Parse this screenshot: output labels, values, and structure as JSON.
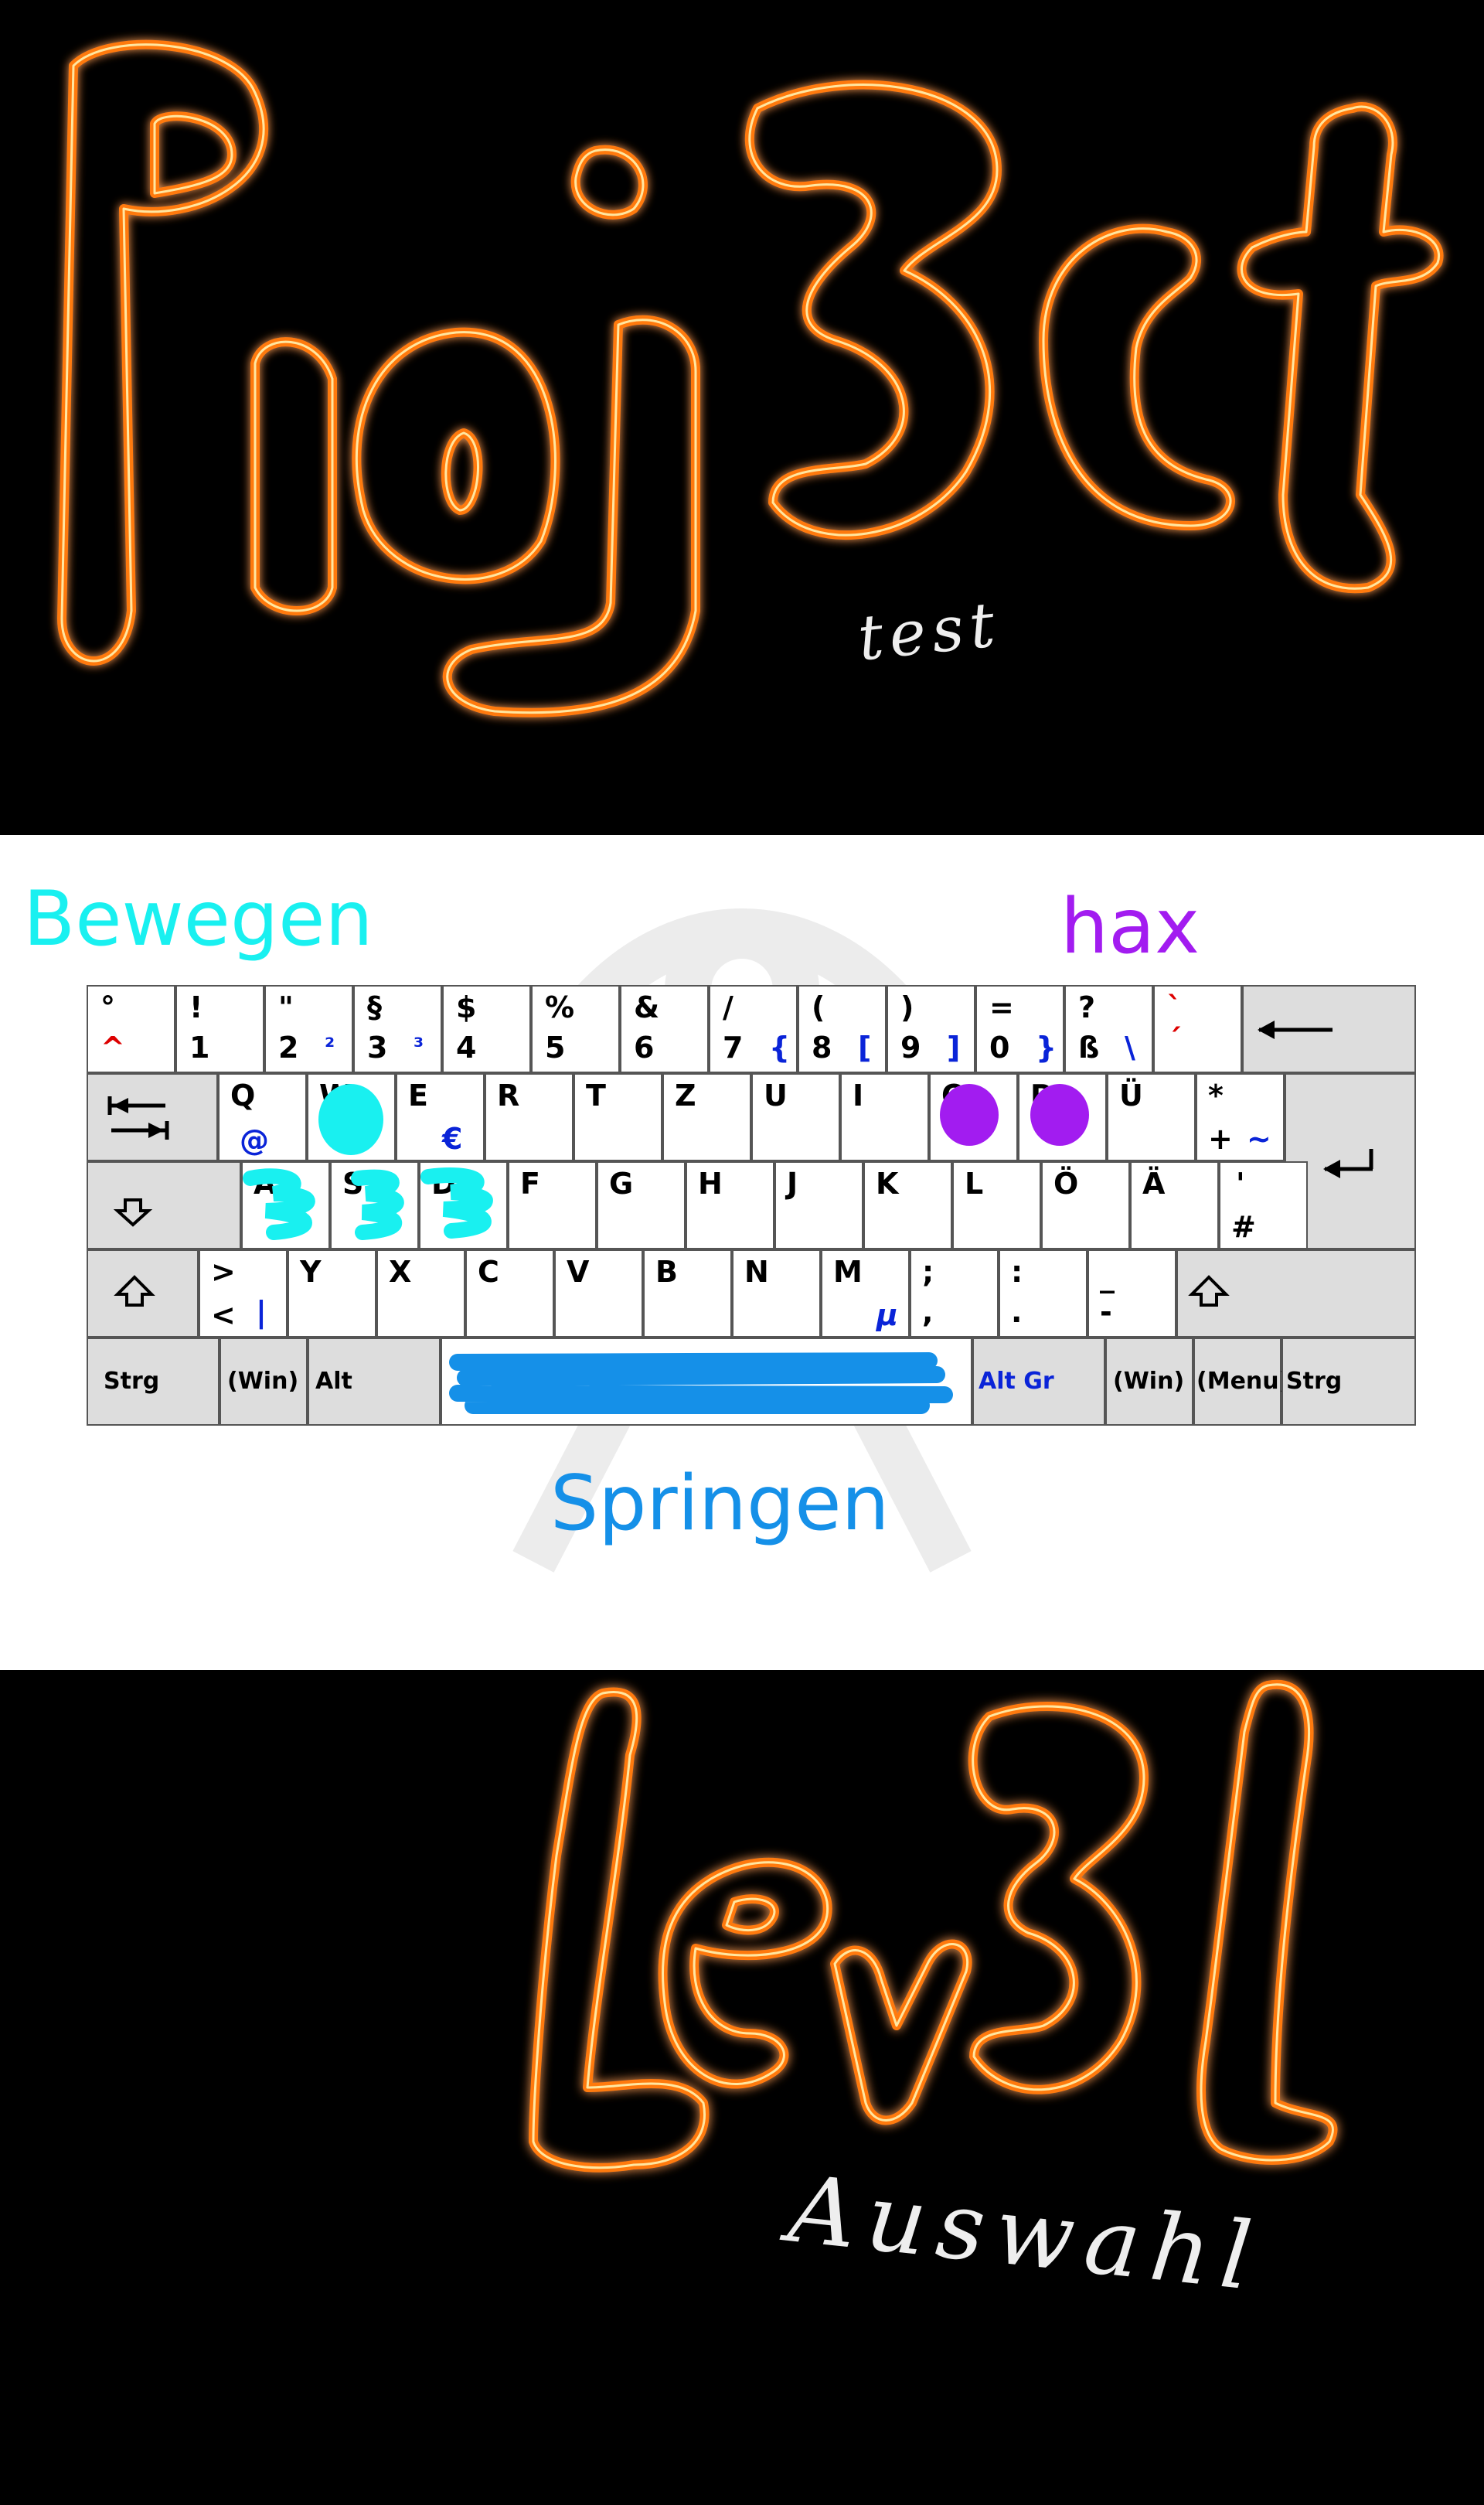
{
  "colors": {
    "fire": "#ff7a10",
    "fire_core": "#fff2b0",
    "bewegen": "#19f0f0",
    "hax": "#a21cf0",
    "springen": "#1590e8",
    "altgr": "#0a24d8"
  },
  "top": {
    "title_word": "Proj3ct",
    "subtitle": "test"
  },
  "middle": {
    "bewegen_label": "Bewegen",
    "hax_label": "hax",
    "springen_label": "Springen",
    "keyboard": {
      "row1": [
        {
          "top": "°",
          "bot": "^"
        },
        {
          "top": "!",
          "bot": "1"
        },
        {
          "top": "\"",
          "bot": "2",
          "alt": "²"
        },
        {
          "top": "§",
          "bot": "3",
          "alt": "³"
        },
        {
          "top": "$",
          "bot": "4"
        },
        {
          "top": "%",
          "bot": "5"
        },
        {
          "top": "&",
          "bot": "6"
        },
        {
          "top": "/",
          "bot": "7",
          "alt": "{"
        },
        {
          "top": "(",
          "bot": "8",
          "alt": "["
        },
        {
          "top": ")",
          "bot": "9",
          "alt": "]"
        },
        {
          "top": "=",
          "bot": "0",
          "alt": "}"
        },
        {
          "top": "?",
          "bot": "ß",
          "alt": "\\"
        },
        {
          "top": "`",
          "bot": "´"
        }
      ],
      "row2": [
        {
          "top": "Q",
          "alt": "@"
        },
        {
          "top": "W"
        },
        {
          "top": "E",
          "alt": "€"
        },
        {
          "top": "R"
        },
        {
          "top": "T"
        },
        {
          "top": "Z"
        },
        {
          "top": "U"
        },
        {
          "top": "I"
        },
        {
          "top": "O"
        },
        {
          "top": "P"
        },
        {
          "top": "Ü"
        },
        {
          "top": "*",
          "bot": "+",
          "alt": "~"
        }
      ],
      "row3": [
        {
          "top": "A"
        },
        {
          "top": "S"
        },
        {
          "top": "D"
        },
        {
          "top": "F"
        },
        {
          "top": "G"
        },
        {
          "top": "H"
        },
        {
          "top": "J"
        },
        {
          "top": "K"
        },
        {
          "top": "L"
        },
        {
          "top": "Ö"
        },
        {
          "top": "Ä"
        },
        {
          "top": "'",
          "bot": "#"
        }
      ],
      "row4": [
        {
          "top": ">",
          "bot": "<",
          "alt": "|"
        },
        {
          "top": "Y"
        },
        {
          "top": "X"
        },
        {
          "top": "C"
        },
        {
          "top": "V"
        },
        {
          "top": "B"
        },
        {
          "top": "N"
        },
        {
          "top": "M",
          "alt": "µ"
        },
        {
          "top": ";",
          "bot": ","
        },
        {
          "top": ":",
          "bot": "."
        },
        {
          "top": "_",
          "bot": "-"
        }
      ],
      "row5": {
        "strg_left": "Strg",
        "win_left": "(Win)",
        "alt": "Alt",
        "altgr": "Alt Gr",
        "win_right": "(Win)",
        "menu": "(Menu)",
        "strg_right": "Strg"
      }
    }
  },
  "bottom": {
    "title_word": "Lev3l",
    "subtitle": "Auswahl"
  }
}
